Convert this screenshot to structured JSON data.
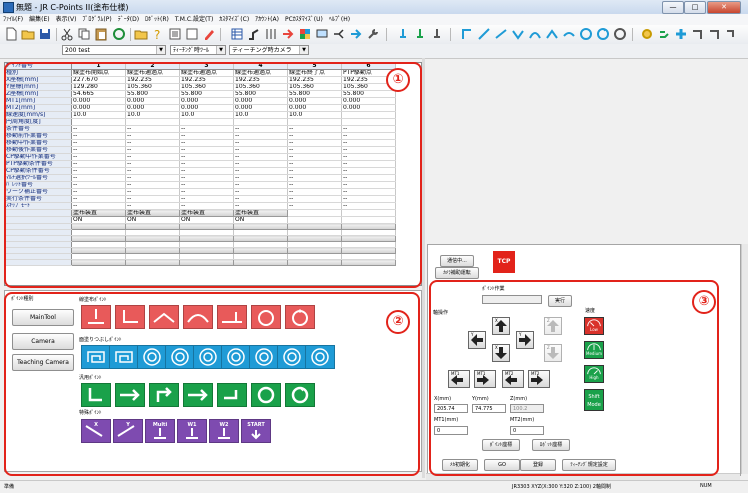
{
  "window": {
    "title": "無題 - JR C-Points II(塗布仕様)",
    "minimize": "—",
    "maximize": "□",
    "close": "✕"
  },
  "menu": [
    "ﾌｧｲﾙ(F)",
    "編集(E)",
    "表示(V)",
    "ﾌﾟﾛｸﾞﾗﾑ(P)",
    "ﾃﾞｰﾀ(D)",
    "ﾛﾎﾞｯﾄ(R)",
    "T.M.C.設定(T)",
    "ｶｽﾀﾏｲｽﾞ(C)",
    "ｱｶｳﾝﾄ(A)",
    "PCｶｽﾀﾏｲｽﾞ(U)",
    "ﾍﾙﾌﾟ(H)"
  ],
  "toolbar2": {
    "program": "200   test",
    "teaching_tool": "ﾃｨｰﾁﾝｸﾞ時ﾂｰﾙ",
    "teaching_camera": "ティーチング時カメラ"
  },
  "grid": {
    "corner": "ﾎﾟｲﾝﾄ番号",
    "columns": [
      "1",
      "2",
      "3",
      "4",
      "5",
      "6"
    ],
    "rows": [
      {
        "label": "種別",
        "values": [
          "線塗布開始点",
          "線塗布通過点",
          "線塗布通過点",
          "線塗布通過点",
          "線塗布終了点",
          "PTP駆動点"
        ]
      },
      {
        "label": "X座標[mm]",
        "values": [
          "227.670",
          "192.235",
          "192.235",
          "192.235",
          "192.235",
          "192.235"
        ]
      },
      {
        "label": "Y座標[mm]",
        "values": [
          "129.280",
          "105.360",
          "105.360",
          "105.360",
          "105.360",
          "105.360"
        ]
      },
      {
        "label": "Z座標[mm]",
        "values": [
          "54.665",
          "55.800",
          "55.800",
          "55.800",
          "55.800",
          "55.800"
        ]
      },
      {
        "label": "MT1[mm]",
        "values": [
          "0.000",
          "0.000",
          "0.000",
          "0.000",
          "0.000",
          "0.000"
        ]
      },
      {
        "label": "MT2[mm]",
        "values": [
          "0.000",
          "0.000",
          "0.000",
          "0.000",
          "0.000",
          "0.000"
        ]
      },
      {
        "label": "線速度[mm/s]",
        "values": [
          "10.0",
          "10.0",
          "10.0",
          "10.0",
          "10.0",
          ""
        ]
      },
      {
        "label": "円周角度[度]",
        "values": [
          "",
          "",
          "",
          "",
          "",
          ""
        ]
      },
      {
        "label": "条件番号",
        "values": [
          "--",
          "--",
          "--",
          "--",
          "--",
          "--"
        ]
      },
      {
        "label": "移動前作業番号",
        "values": [
          "--",
          "--",
          "--",
          "--",
          "--",
          "--"
        ]
      },
      {
        "label": "移動中作業番号",
        "values": [
          "--",
          "--",
          "--",
          "--",
          "--",
          "--"
        ]
      },
      {
        "label": "移動後作業番号",
        "values": [
          "--",
          "--",
          "--",
          "--",
          "--",
          "--"
        ]
      },
      {
        "label": "CP駆動中作業番号",
        "values": [
          "--",
          "--",
          "--",
          "--",
          "--",
          "--"
        ]
      },
      {
        "label": "PTP駆動条件番号",
        "values": [
          "--",
          "--",
          "--",
          "--",
          "--",
          "--"
        ]
      },
      {
        "label": "CP駆動条件番号",
        "values": [
          "--",
          "--",
          "--",
          "--",
          "--",
          "--"
        ]
      },
      {
        "label": "ﾏﾙﾁ選択ﾂｰﾙ番号",
        "values": [
          "--",
          "--",
          "--",
          "--",
          "--",
          "--"
        ]
      },
      {
        "label": "ﾊﾟﾚｯﾄ番号",
        "values": [
          "--",
          "--",
          "--",
          "--",
          "--",
          "--"
        ]
      },
      {
        "label": "ワーク補正番号",
        "values": [
          "--",
          "--",
          "--",
          "--",
          "--",
          "--"
        ]
      },
      {
        "label": "実行条件番号",
        "values": [
          "--",
          "--",
          "--",
          "--",
          "--",
          "--"
        ]
      },
      {
        "label": "ｽｷｯﾌﾟﾓｰﾄﾞ",
        "values": [
          "--",
          "--",
          "--",
          "--",
          "--",
          "--"
        ]
      }
    ],
    "device_label": "塗布装置",
    "device_state": "ON"
  },
  "callouts": {
    "one": "①",
    "two": "②",
    "three": "③"
  },
  "left": {
    "buttons": [
      "MainTool",
      "Camera",
      "Teaching Camera"
    ],
    "point_types_label": "ﾎﾟｲﾝﾄ種別",
    "sections": [
      "線塗布ﾎﾟｲﾝﾄ",
      "面塗りつぶしﾎﾟｲﾝﾄ",
      "汎用ﾎﾟｲﾝﾄ",
      "特殊ﾎﾟｲﾝﾄ"
    ],
    "special_tiles": [
      "X",
      "Y",
      "Multi",
      "W1",
      "W2",
      "START"
    ],
    "special_sub": [
      "1",
      "2"
    ],
    "colors": {
      "red": "#e85a5a",
      "blue": "#1f9bd6",
      "green": "#1aa14a",
      "purple": "#7e4bb0"
    }
  },
  "right": {
    "moving_btn": "通信中...",
    "camera_btn": "ｶﾒﾗ補助運転",
    "tcp_label": "TCP",
    "point_work_label": "ﾎﾟｲﾝﾄ作業",
    "exec_btn": "実行",
    "axis_label": "軸操作",
    "speed_label": "速度",
    "speed": [
      "Low",
      "Medium",
      "High"
    ],
    "shift_mode": "Shift Mode",
    "jog_x": "X",
    "jog_y": "Y",
    "jog_z": "Z",
    "mt": [
      "MT1",
      "MT1",
      "MT2",
      "MT2"
    ],
    "x_label": "X(mm)",
    "y_label": "Y(mm)",
    "z_label": "Z(mm)",
    "x_val": "205.74",
    "y_val": "74.775",
    "z_val": "100.2",
    "mt1_label": "MT1(mm)",
    "mt2_label": "MT2(mm)",
    "mt1_val": "0",
    "mt2_val": "0",
    "point_coord_btn": "ﾎﾟｲﾝﾄ座標",
    "robot_coord_btn": "ﾛﾎﾞｯﾄ座標",
    "bottom_btns": [
      "ﾒｶ初期化",
      "GO",
      "登録",
      "ﾃｨｰﾁﾝｸﾞ規定設定"
    ]
  },
  "status": {
    "left": "準備",
    "center": "JR3303 XYZ(X:300 Y:320 Z:100) 2軸間制",
    "right": "NUM"
  }
}
